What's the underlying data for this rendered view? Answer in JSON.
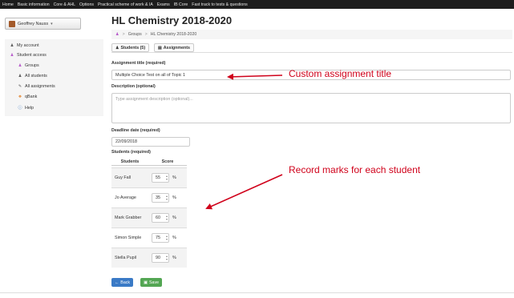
{
  "topnav": {
    "items": [
      "Home",
      "Basic information",
      "Core & AHL",
      "Options",
      "Practical scheme of work & IA",
      "Exams",
      "IB Core",
      "Fast track to tests & questions"
    ]
  },
  "user": {
    "name": "Geoffrey Nauss"
  },
  "sidebar": {
    "items": [
      {
        "label": "My account",
        "icon": "user-icon"
      },
      {
        "label": "Student access",
        "icon": "users-icon"
      },
      {
        "label": "Groups",
        "icon": "users-icon"
      },
      {
        "label": "All students",
        "icon": "user-icon"
      },
      {
        "label": "All assignments",
        "icon": "pencil-icon"
      },
      {
        "label": "qBank",
        "icon": "qbank-icon"
      },
      {
        "label": "Help",
        "icon": "info-icon"
      }
    ]
  },
  "page": {
    "title": "HL Chemistry 2018-2020",
    "breadcrumb": {
      "groups": "Groups",
      "current": "HL Chemistry 2018-2020"
    },
    "tabs": [
      {
        "label": "Students (5)",
        "icon": "user-icon"
      },
      {
        "label": "Assignments",
        "icon": "document-icon"
      }
    ]
  },
  "form": {
    "title_label": "Assignment title (required)",
    "title_value": "Multiple Choice Test on all of Topic 1",
    "desc_label": "Description (optional)",
    "desc_placeholder": "Type assignment description (optional)...",
    "deadline_label": "Deadline date (required)",
    "deadline_value": "22/09/2018",
    "students_label": "Students (required)",
    "col_students": "Students",
    "col_score": "Score",
    "pct": "%",
    "students": [
      {
        "name": "Guy Fall",
        "score": "55"
      },
      {
        "name": "Jo Average",
        "score": "35"
      },
      {
        "name": "Mark Grabber",
        "score": "60"
      },
      {
        "name": "Simon Simple",
        "score": "75"
      },
      {
        "name": "Stella Pupil",
        "score": "90"
      }
    ],
    "back_label": "Back",
    "save_label": "Save"
  },
  "annotations": {
    "title_note": "Custom assignment title",
    "marks_note": "Record marks for each student"
  },
  "colors": {
    "accent_blue": "#3a7ac6",
    "save_green": "#53a653",
    "annotation_red": "#d0021b",
    "nav_bg": "#1d1d1d"
  }
}
